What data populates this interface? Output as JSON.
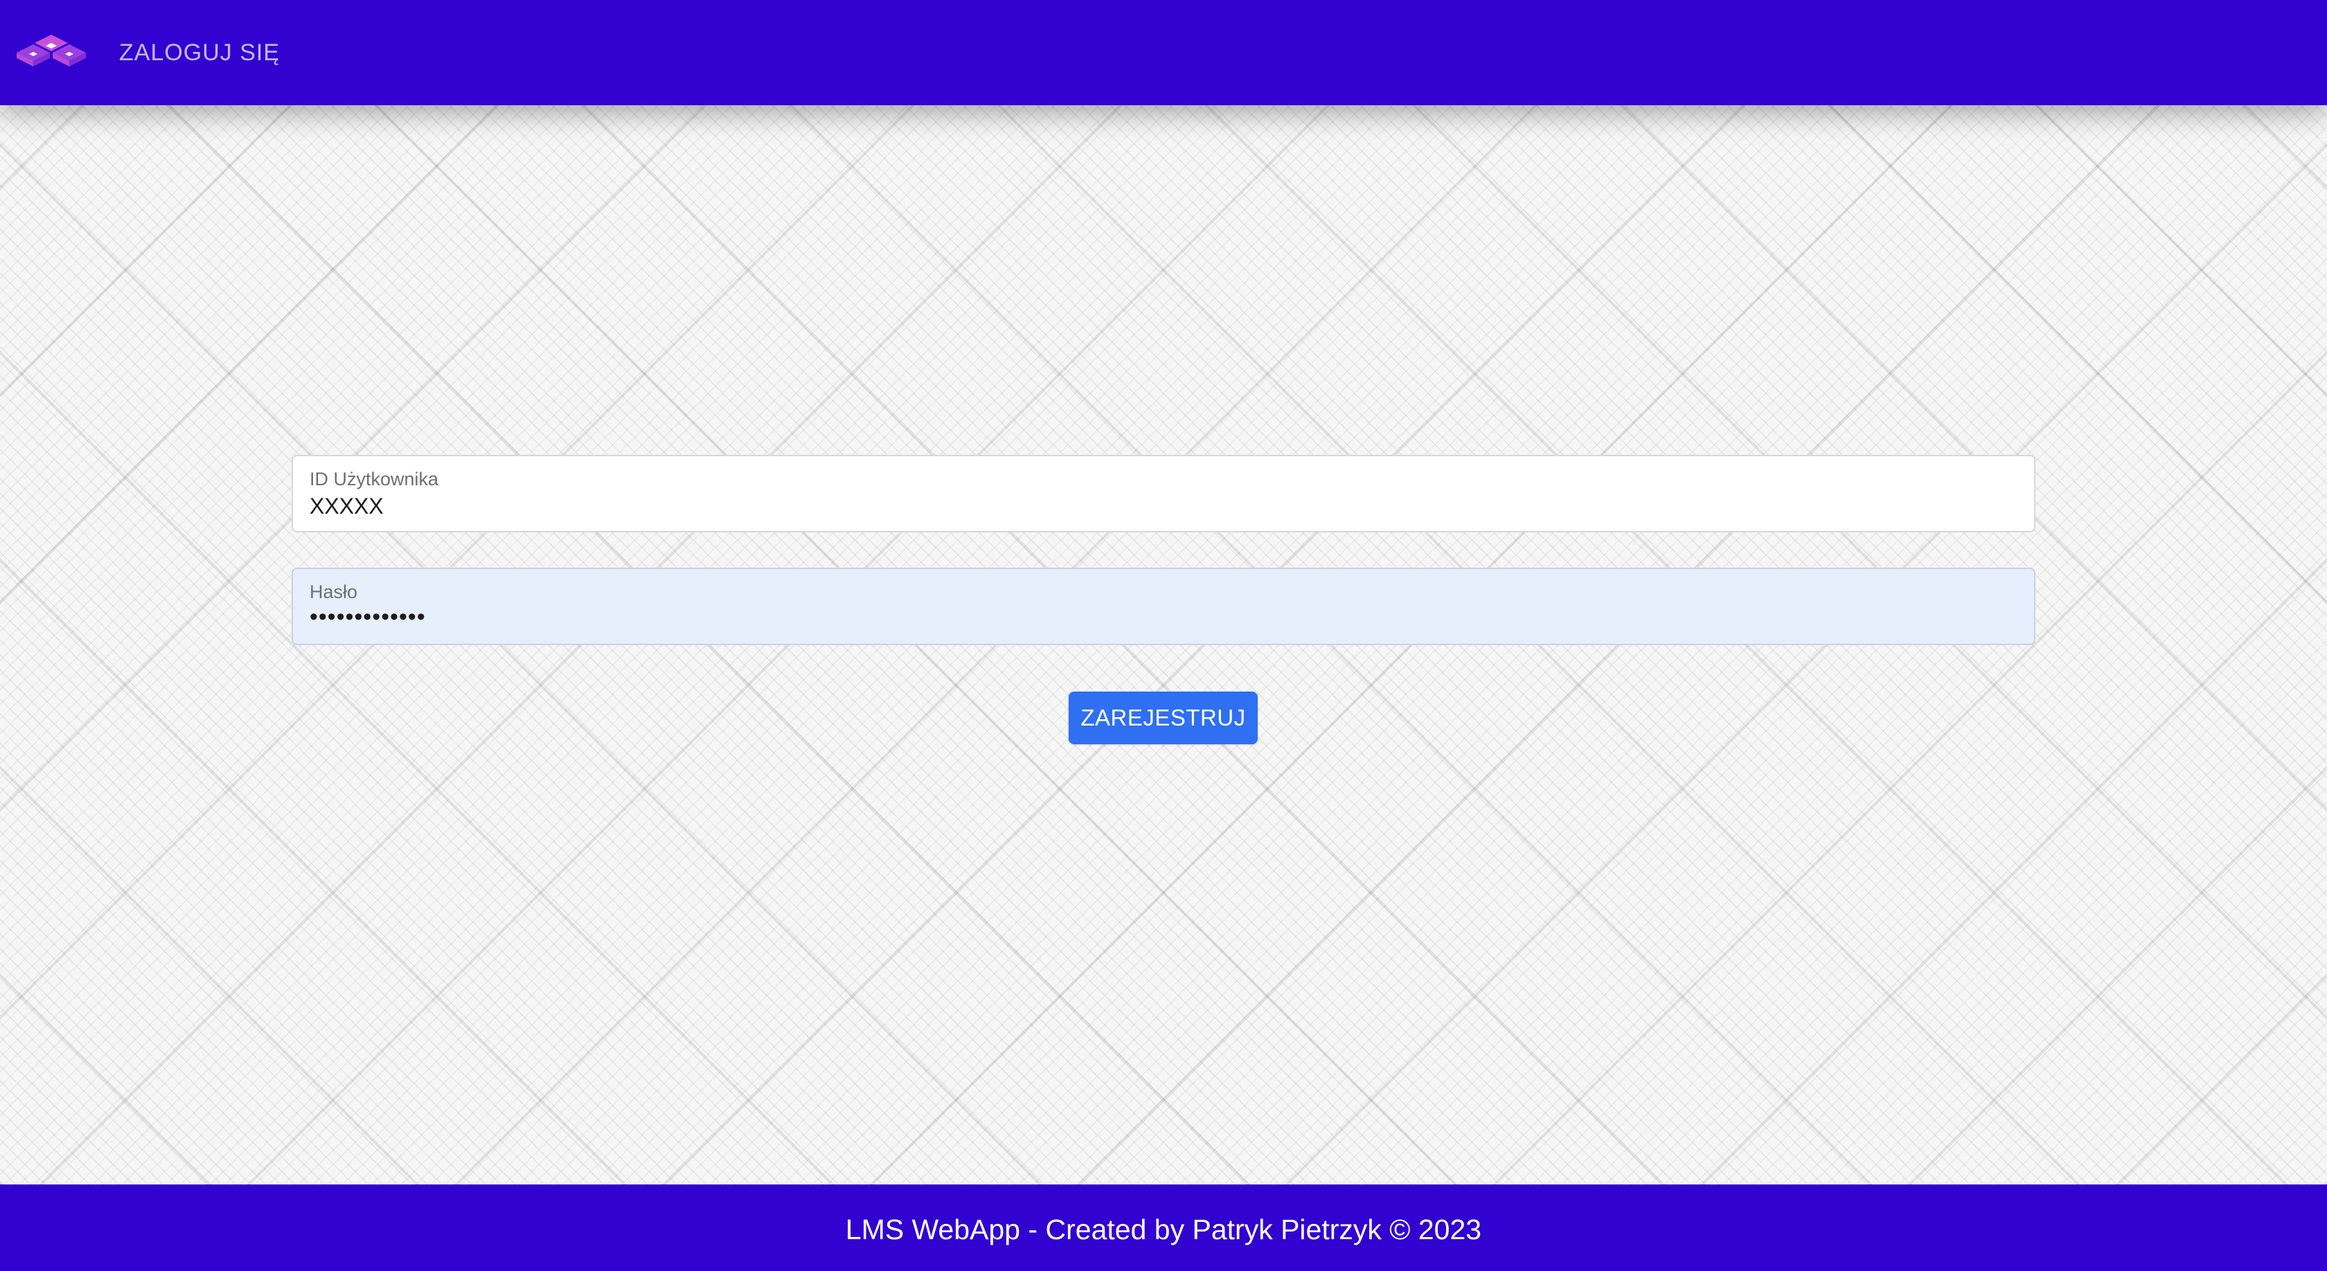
{
  "header": {
    "login_link": "ZALOGUJ SIĘ",
    "logo_icon": "isometric-cubes-logo-icon"
  },
  "form": {
    "user_id": {
      "label": "ID Użytkownika",
      "value": "XXXXX"
    },
    "password": {
      "label": "Hasło",
      "value": "•••••••••••••"
    },
    "submit_label": "ZAREJESTRUJ"
  },
  "footer": {
    "text": "LMS WebApp - Created by Patryk Pietrzyk © 2023"
  },
  "colors": {
    "header_bg": "#3102d0",
    "footer_bg": "#3102d0",
    "button_bg": "#2f6ff2",
    "autofill_bg": "#e8effc",
    "logo_accent": "#c452d8"
  }
}
